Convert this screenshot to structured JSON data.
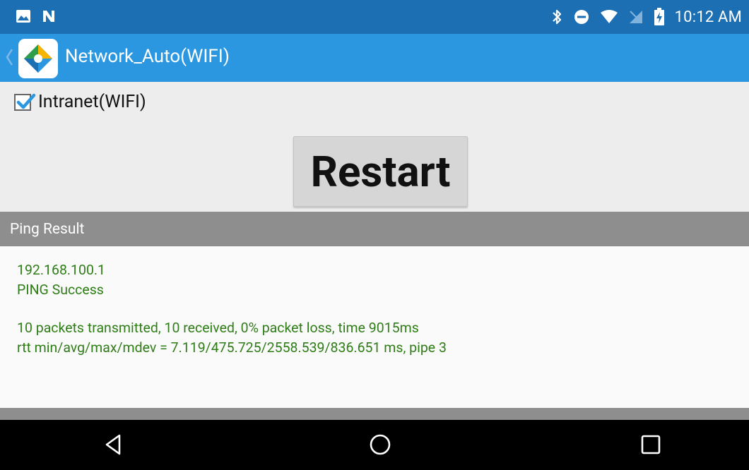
{
  "status_bar": {
    "time": "10:12 AM",
    "left_icons": [
      "image-icon",
      "n-notification-icon"
    ],
    "right_icons": [
      "bluetooth-icon",
      "do-not-disturb-icon",
      "wifi-icon",
      "no-signal-icon",
      "battery-charging-icon"
    ]
  },
  "app_bar": {
    "title": "Network_Auto(WIFI)",
    "accent_color": "#2b97e0"
  },
  "intranet_checkbox": {
    "label": "Intranet(WIFI)",
    "checked": true
  },
  "restart_button": {
    "label": "Restart"
  },
  "ping_result": {
    "header": "Ping Result",
    "lines": [
      "192.168.100.1",
      "PING Success",
      "10 packets transmitted, 10 received, 0% packet loss, time 9015ms",
      "rtt min/avg/max/mdev = 7.119/475.725/2558.539/836.651 ms, pipe 3"
    ],
    "text_color": "#2e7d16"
  },
  "nav_bar": {
    "buttons": [
      "back-icon",
      "home-icon",
      "recents-icon"
    ]
  }
}
